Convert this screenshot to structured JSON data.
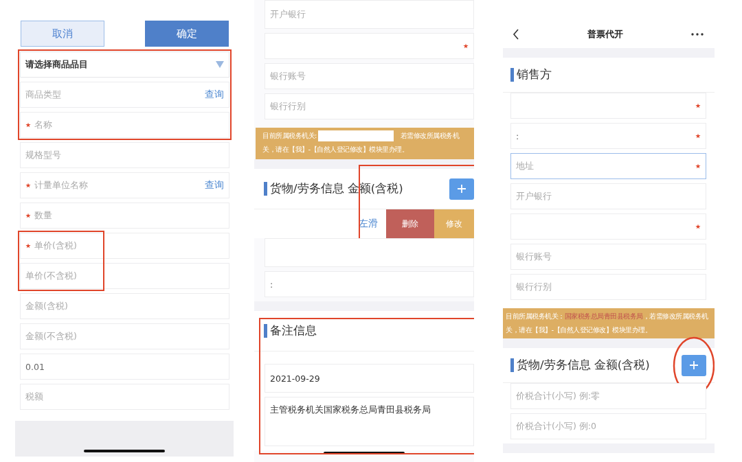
{
  "panels": [
    {
      "kind": "goods_form",
      "blocks": [
        {
          "kind": "buttons",
          "items": [
            {
              "label": "取消",
              "kind": "secondary"
            },
            {
              "label": "确定",
              "kind": "primary"
            }
          ]
        },
        {
          "kind": "fields",
          "annotation": {
            "kind": "frame"
          },
          "items": [
            {
              "kind": "select",
              "value": "请选择商品品目",
              "required": false
            },
            {
              "kind": "input",
              "placeholder": "商品类型",
              "required": false,
              "action": "查询"
            },
            {
              "kind": "input",
              "placeholder": "名称",
              "required": true
            }
          ]
        },
        {
          "kind": "fields",
          "items": [
            {
              "kind": "input",
              "placeholder": "规格型号",
              "required": false
            },
            {
              "kind": "input",
              "placeholder": "计量单位名称",
              "required": true,
              "action": "查询"
            },
            {
              "kind": "input",
              "placeholder": "数量",
              "required": true
            }
          ]
        },
        {
          "kind": "fields",
          "annotation": {
            "kind": "frame_left"
          },
          "items": [
            {
              "kind": "input",
              "placeholder": "单价(含税)",
              "required": true
            },
            {
              "kind": "input",
              "placeholder": "单价(不含税)",
              "required": false
            }
          ]
        },
        {
          "kind": "fields",
          "items": [
            {
              "kind": "input",
              "placeholder": "金额(含税)"
            },
            {
              "kind": "input",
              "placeholder": "金额(不含税)"
            },
            {
              "kind": "input",
              "value": "0.01"
            },
            {
              "kind": "input",
              "placeholder": "税额"
            }
          ]
        },
        {
          "kind": "footer"
        }
      ]
    },
    {
      "kind": "buyer_form",
      "blocks": [
        {
          "kind": "fields",
          "items": [
            {
              "kind": "input",
              "placeholder": "开户银行",
              "required": false
            },
            {
              "kind": "input",
              "required": true
            },
            {
              "kind": "input",
              "placeholder": "银行账号",
              "required": false
            },
            {
              "kind": "input",
              "placeholder": "银行行别",
              "required": false
            }
          ]
        },
        {
          "kind": "notice",
          "segments": [
            {
              "kind": "text",
              "text": "目前所属税务机关:"
            },
            {
              "kind": "redacted"
            },
            {
              "kind": "text",
              "text": "若需修改所属税务机"
            },
            {
              "kind": "text",
              "text": "关，请在【我】-【自然人登记修改】模块里办理。"
            }
          ]
        },
        {
          "kind": "spacer"
        },
        {
          "kind": "section",
          "title": "货物/劳务信息 金额(含税)",
          "add_button": true,
          "annotation": {
            "kind": "frame_right"
          },
          "swipe_row": {
            "hint": "左滑",
            "actions": [
              {
                "label": "删除",
                "kind": "delete"
              },
              {
                "label": "修改",
                "kind": "edit"
              }
            ]
          }
        },
        {
          "kind": "fields",
          "items": [
            {
              "kind": "input"
            },
            {
              "kind": "input",
              "value": ":"
            }
          ]
        },
        {
          "kind": "spacer"
        },
        {
          "kind": "section",
          "title": "备注信息",
          "annotation": {
            "kind": "frame"
          },
          "fields": [
            {
              "kind": "input",
              "value": "2021-09-29"
            },
            {
              "kind": "textarea",
              "value": "主管税务机关国家税务总局青田县税务局"
            }
          ]
        },
        {
          "kind": "home_bar"
        }
      ]
    },
    {
      "kind": "seller_form",
      "blocks": [
        {
          "kind": "navbar",
          "title": "普票代开"
        },
        {
          "kind": "spacer"
        },
        {
          "kind": "section",
          "title": "销售方"
        },
        {
          "kind": "fields",
          "items": [
            {
              "kind": "input",
              "required": true
            },
            {
              "kind": "input",
              "value": ":",
              "required": true
            },
            {
              "kind": "input",
              "placeholder": "地址",
              "required": true,
              "focused": true
            },
            {
              "kind": "input",
              "placeholder": "开户银行",
              "required": false
            },
            {
              "kind": "input",
              "required": true
            },
            {
              "kind": "input",
              "placeholder": "银行账号",
              "required": false
            },
            {
              "kind": "input",
              "placeholder": "银行行别",
              "required": false
            }
          ]
        },
        {
          "kind": "notice",
          "segments": [
            {
              "kind": "text",
              "text": "目前所属税务机关："
            },
            {
              "kind": "authority",
              "text": "国家税务总局青田县税务局"
            },
            {
              "kind": "text",
              "text": "，若需修改所属税务机"
            },
            {
              "kind": "text",
              "text": "关，请在【我】-【自然人登记修改】模块里办理。"
            }
          ]
        },
        {
          "kind": "spacer"
        },
        {
          "kind": "section",
          "title": "货物/劳务信息 金额(含税)",
          "add_button": true,
          "annotation": {
            "kind": "circle"
          }
        },
        {
          "kind": "fields",
          "items": [
            {
              "kind": "input",
              "placeholder": "价税合计(小写) 例:零"
            },
            {
              "kind": "input",
              "placeholder": "价税合计(小写) 例:0"
            }
          ]
        },
        {
          "kind": "spacer"
        }
      ]
    }
  ]
}
